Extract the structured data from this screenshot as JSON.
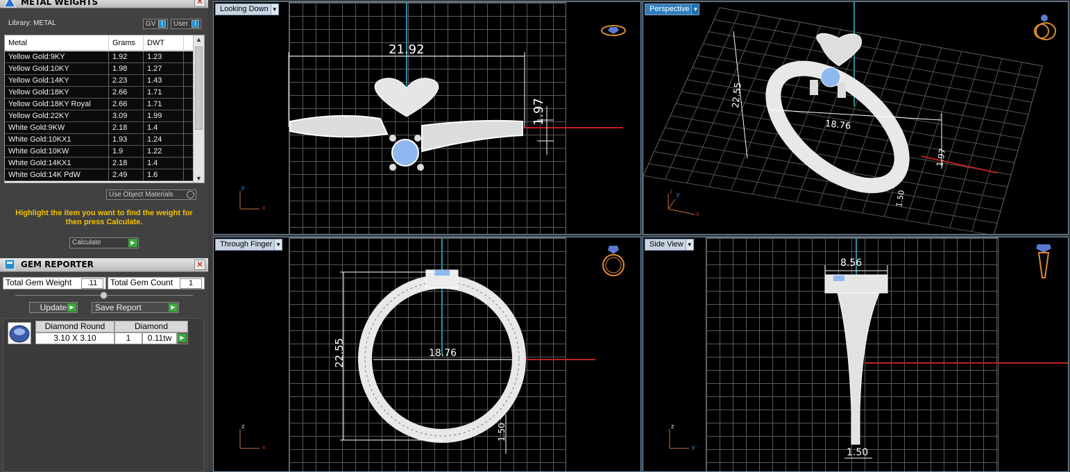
{
  "metal_weights": {
    "title": "METAL WEIGHTS",
    "library_label": "Library: METAL",
    "gv_label": "GV",
    "user_label": "User",
    "columns": [
      "Metal",
      "Grams",
      "DWT"
    ],
    "rows": [
      {
        "metal": "Yellow Gold:9KY",
        "grams": "1.92",
        "dwt": "1.23"
      },
      {
        "metal": "Yellow Gold:10KY",
        "grams": "1.98",
        "dwt": "1.27"
      },
      {
        "metal": "Yellow Gold:14KY",
        "grams": "2.23",
        "dwt": "1.43"
      },
      {
        "metal": "Yellow Gold:18KY",
        "grams": "2.66",
        "dwt": "1.71"
      },
      {
        "metal": "Yellow Gold:18KY Royal",
        "grams": "2.66",
        "dwt": "1.71"
      },
      {
        "metal": "Yellow Gold:22KY",
        "grams": "3.09",
        "dwt": "1.99"
      },
      {
        "metal": "White Gold:9KW",
        "grams": "2.18",
        "dwt": "1.4"
      },
      {
        "metal": "White Gold:10KX1",
        "grams": "1.93",
        "dwt": "1.24"
      },
      {
        "metal": "White Gold:10KW",
        "grams": "1.9",
        "dwt": "1.22"
      },
      {
        "metal": "White Gold:14KX1",
        "grams": "2.18",
        "dwt": "1.4"
      },
      {
        "metal": "White Gold:14K PdW",
        "grams": "2.49",
        "dwt": "1.6"
      }
    ],
    "use_object_materials": "Use Object Materials",
    "hint": "Highlight the item you want to find the weight for then press Calculate.",
    "calculate_label": "Calculate"
  },
  "gem_reporter": {
    "title": "GEM REPORTER",
    "total_weight_label": "Total Gem Weight",
    "total_weight_value": ".11",
    "total_count_label": "Total Gem Count",
    "total_count_value": "1",
    "update_label": "Update",
    "save_report_label": "Save Report",
    "gem": {
      "shape": "Diamond Round",
      "size": "3.10 X 3.10",
      "type": "Diamond",
      "count": "1",
      "weight": "0.11tw"
    }
  },
  "viewports": {
    "top": {
      "label": "Looking Down",
      "dim_width": "21.92",
      "dim_height": "1.97",
      "axis1": "y",
      "axis2": "x"
    },
    "perspective": {
      "label": "Perspective",
      "dim_height": "22.55",
      "dim_width": "18.76",
      "dim_small": "1.97",
      "dim_band": "1.50",
      "axis1": "z",
      "axis2": "y",
      "axis3": "x"
    },
    "front": {
      "label": "Through Finger",
      "dim_height": "22.55",
      "dim_width": "18.76",
      "dim_band": "1.50",
      "axis1": "z",
      "axis2": "x"
    },
    "side": {
      "label": "Side View",
      "dim_top": "8.56",
      "dim_band": "1.50",
      "axis1": "z",
      "axis2": "y"
    }
  },
  "colors": {
    "stone": "#8fb8f0",
    "axis_red": "#c02020",
    "axis_teal": "#2a8ca8",
    "hint_yellow": "#f2c200",
    "tab_active": "#2f7fc0"
  }
}
